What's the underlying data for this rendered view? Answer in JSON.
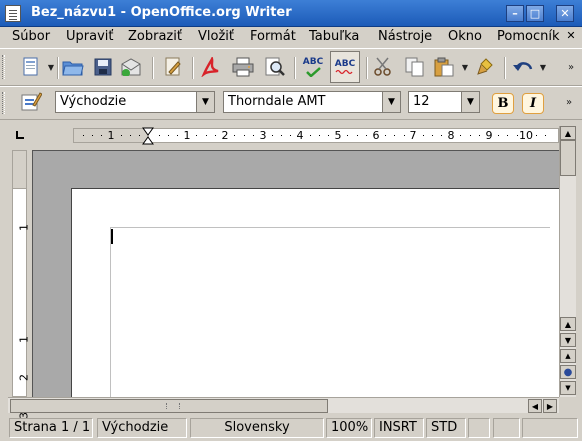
{
  "window": {
    "title": "Bez_názvu1 - OpenOffice.org Writer"
  },
  "titlebar_buttons": {
    "minimize": "–",
    "maximize": "□",
    "close": "✕"
  },
  "menu": {
    "items": [
      "Súbor",
      "Upraviť",
      "Zobraziť",
      "Vložiť",
      "Formát",
      "Tabuľka",
      "Nástroje",
      "Okno",
      "Pomocník"
    ],
    "close_doc": "✕"
  },
  "toolbar_standard": {
    "icons": [
      "new-document-icon",
      "open-folder-icon",
      "save-icon",
      "edit-file-icon",
      "export-pdf-icon",
      "print-icon",
      "page-preview-icon",
      "spellcheck-icon",
      "autospellcheck-icon",
      "cut-icon",
      "copy-icon",
      "paste-icon",
      "clone-formatting-icon",
      "undo-icon"
    ],
    "spell_label": "ABC",
    "autospell_label": "ABC"
  },
  "toolbar_formatting": {
    "paragraph_style": "Východzie",
    "font_name": "Thorndale AMT",
    "font_size": "12",
    "bold_label": "B",
    "italic_label": "I"
  },
  "ruler": {
    "h_labels": [
      "1",
      "1",
      "2",
      "3",
      "4",
      "5",
      "6",
      "7",
      "8",
      "9",
      "10"
    ],
    "v_labels": [
      "1",
      "1",
      "2",
      "3"
    ]
  },
  "statusbar": {
    "page": "Strana 1 / 1",
    "style": "Východzie",
    "language": "Slovensky",
    "zoom": "100%",
    "insert_mode": "INSRT",
    "selection_mode": "STD"
  },
  "colors": {
    "titlebar": "#2a6ac7",
    "chrome": "#d4d0c8",
    "doc_background": "#a9a9a9",
    "accent_orange": "#e0a040"
  }
}
